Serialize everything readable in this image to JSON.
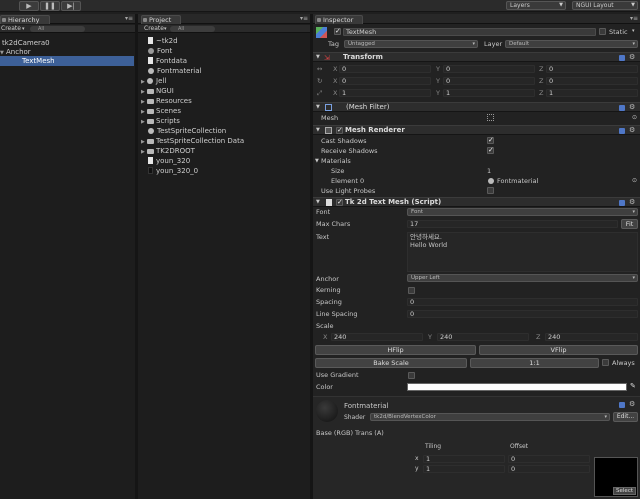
{
  "toolbar": {
    "play": "▶",
    "pause": "❚❚",
    "step": "▶|",
    "layers": "Layers",
    "layout": "NGUI Layout"
  },
  "hierarchy": {
    "tab": "Hierarchy",
    "create": "Create",
    "search": "All",
    "items": [
      "tk2dCamera0",
      "Anchor",
      "TextMesh"
    ]
  },
  "project": {
    "tab": "Project",
    "create": "Create",
    "search": "All",
    "items": [
      "~tk2d",
      "Font",
      "Fontdata",
      "Fontmaterial",
      "Jell",
      "NGUI",
      "Resources",
      "Scenes",
      "Scripts",
      "TestSpriteCollection",
      "TestSpriteCollection Data",
      "TK2DROOT",
      "youn_320",
      "youn_320_0"
    ]
  },
  "inspector": {
    "tab": "Inspector",
    "name": "TextMesh",
    "static_label": "Static",
    "tag_label": "Tag",
    "tag_value": "Untagged",
    "layer_label": "Layer",
    "layer_value": "Default",
    "transform": {
      "title": "Transform",
      "rows": [
        {
          "x": "0",
          "y": "0",
          "z": "0"
        },
        {
          "x": "0",
          "y": "0",
          "z": "0"
        },
        {
          "x": "1",
          "y": "1",
          "z": "1"
        }
      ]
    },
    "mesh_filter": {
      "title": "(Mesh Filter)",
      "mesh_label": "Mesh"
    },
    "mesh_renderer": {
      "title": "Mesh Renderer",
      "cast_shadows": "Cast Shadows",
      "receive_shadows": "Receive Shadows",
      "materials": "Materials",
      "size_label": "Size",
      "size_value": "1",
      "element_label": "Element 0",
      "element_value": "Fontmaterial",
      "light_probes": "Use Light Probes"
    },
    "text_mesh": {
      "title": "Tk 2d Text Mesh (Script)",
      "font_label": "Font",
      "font_value": "Font",
      "max_chars_label": "Max Chars",
      "max_chars_value": "17",
      "fit": "Fit",
      "text_label": "Text",
      "text_line1": "안녕하세요.",
      "text_line2": "Hello World",
      "anchor_label": "Anchor",
      "anchor_value": "Upper Left",
      "kerning_label": "Kerning",
      "spacing_label": "Spacing",
      "spacing_value": "0",
      "line_spacing_label": "Line Spacing",
      "line_spacing_value": "0",
      "scale_label": "Scale",
      "scale": {
        "x": "240",
        "y": "240",
        "z": "240"
      },
      "hflip": "HFlip",
      "vflip": "VFlip",
      "bake_scale": "Bake Scale",
      "one_to_one": "1:1",
      "always": "Always",
      "use_gradient": "Use Gradient",
      "color_label": "Color"
    },
    "material": {
      "name": "Fontmaterial",
      "shader_label": "Shader",
      "shader_value": "tk2d/BlendVertexColor",
      "edit": "Edit...",
      "base_label": "Base (RGB) Trans (A)",
      "tiling": "Tiling",
      "offset": "Offset",
      "x_label": "x",
      "y_label": "y",
      "tiling_x": "1",
      "tiling_y": "1",
      "offset_x": "0",
      "offset_y": "0",
      "select": "Select"
    }
  }
}
